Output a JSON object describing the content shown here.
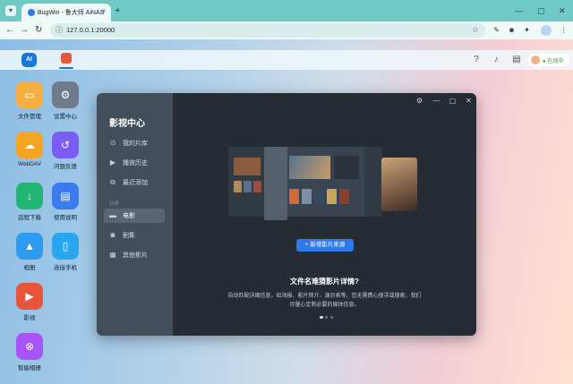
{
  "browser": {
    "tab_title": "BugWin - 鲁大师 AiNAS",
    "tab_close": "×",
    "new_tab": "+",
    "url": "127.0.0.1:20000",
    "controls": {
      "minimize": "—",
      "maximize": "▢",
      "close": "✕"
    },
    "nav": {
      "back": "←",
      "forward": "→",
      "reload": "↻"
    }
  },
  "nas": {
    "logo": "AI",
    "user_status": "●  在线中",
    "desktop_apps": [
      {
        "label": "文件管理",
        "color": "#f5b041"
      },
      {
        "label": "设置中心",
        "color": "#6d7b8d"
      },
      {
        "label": "WebDAV",
        "color": "#f5a524"
      },
      {
        "label": "问题反馈",
        "color": "#7b5cf5"
      },
      {
        "label": "远程下载",
        "color": "#22b573"
      },
      {
        "label": "使用说明",
        "color": "#3a7bf0"
      },
      {
        "label": "相册",
        "color": "#2d9cf0"
      },
      {
        "label": "连接手机",
        "color": "#28a7f0"
      },
      {
        "label": "影视",
        "color": "#e9553a"
      },
      {
        "label": "智能相册",
        "color": "#a855f7"
      }
    ]
  },
  "window": {
    "title": "影视中心",
    "menu": [
      {
        "label": "我的片库",
        "icon": "library-icon"
      },
      {
        "label": "播放历史",
        "icon": "history-icon"
      },
      {
        "label": "最近添加",
        "icon": "recent-icon"
      }
    ],
    "section_label": "分类",
    "categories": [
      {
        "label": "电影",
        "icon": "movie-icon",
        "active": true
      },
      {
        "label": "剧集",
        "icon": "series-icon",
        "active": false
      },
      {
        "label": "其他影片",
        "icon": "other-icon",
        "active": false
      }
    ],
    "add_button": "+ 新增影片来源",
    "prompt_title": "文件名难猜影片详情?",
    "prompt_line1": "自动匹配详细信息，如海报、影片简介、演员表等。您无需费心搜寻或搜索，我们",
    "prompt_line2": "尽量心定制必要的媒体信息。",
    "carousel_pages": 3,
    "carousel_active": 0
  }
}
